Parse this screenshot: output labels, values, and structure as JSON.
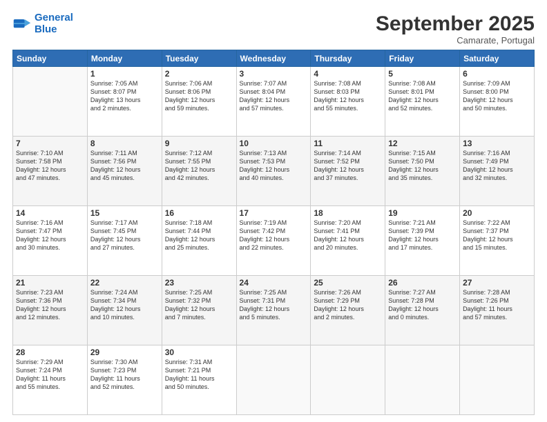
{
  "logo": {
    "line1": "General",
    "line2": "Blue"
  },
  "title": "September 2025",
  "subtitle": "Camarate, Portugal",
  "days_header": [
    "Sunday",
    "Monday",
    "Tuesday",
    "Wednesday",
    "Thursday",
    "Friday",
    "Saturday"
  ],
  "weeks": [
    [
      {
        "num": "",
        "info": ""
      },
      {
        "num": "1",
        "info": "Sunrise: 7:05 AM\nSunset: 8:07 PM\nDaylight: 13 hours\nand 2 minutes."
      },
      {
        "num": "2",
        "info": "Sunrise: 7:06 AM\nSunset: 8:06 PM\nDaylight: 12 hours\nand 59 minutes."
      },
      {
        "num": "3",
        "info": "Sunrise: 7:07 AM\nSunset: 8:04 PM\nDaylight: 12 hours\nand 57 minutes."
      },
      {
        "num": "4",
        "info": "Sunrise: 7:08 AM\nSunset: 8:03 PM\nDaylight: 12 hours\nand 55 minutes."
      },
      {
        "num": "5",
        "info": "Sunrise: 7:08 AM\nSunset: 8:01 PM\nDaylight: 12 hours\nand 52 minutes."
      },
      {
        "num": "6",
        "info": "Sunrise: 7:09 AM\nSunset: 8:00 PM\nDaylight: 12 hours\nand 50 minutes."
      }
    ],
    [
      {
        "num": "7",
        "info": "Sunrise: 7:10 AM\nSunset: 7:58 PM\nDaylight: 12 hours\nand 47 minutes."
      },
      {
        "num": "8",
        "info": "Sunrise: 7:11 AM\nSunset: 7:56 PM\nDaylight: 12 hours\nand 45 minutes."
      },
      {
        "num": "9",
        "info": "Sunrise: 7:12 AM\nSunset: 7:55 PM\nDaylight: 12 hours\nand 42 minutes."
      },
      {
        "num": "10",
        "info": "Sunrise: 7:13 AM\nSunset: 7:53 PM\nDaylight: 12 hours\nand 40 minutes."
      },
      {
        "num": "11",
        "info": "Sunrise: 7:14 AM\nSunset: 7:52 PM\nDaylight: 12 hours\nand 37 minutes."
      },
      {
        "num": "12",
        "info": "Sunrise: 7:15 AM\nSunset: 7:50 PM\nDaylight: 12 hours\nand 35 minutes."
      },
      {
        "num": "13",
        "info": "Sunrise: 7:16 AM\nSunset: 7:49 PM\nDaylight: 12 hours\nand 32 minutes."
      }
    ],
    [
      {
        "num": "14",
        "info": "Sunrise: 7:16 AM\nSunset: 7:47 PM\nDaylight: 12 hours\nand 30 minutes."
      },
      {
        "num": "15",
        "info": "Sunrise: 7:17 AM\nSunset: 7:45 PM\nDaylight: 12 hours\nand 27 minutes."
      },
      {
        "num": "16",
        "info": "Sunrise: 7:18 AM\nSunset: 7:44 PM\nDaylight: 12 hours\nand 25 minutes."
      },
      {
        "num": "17",
        "info": "Sunrise: 7:19 AM\nSunset: 7:42 PM\nDaylight: 12 hours\nand 22 minutes."
      },
      {
        "num": "18",
        "info": "Sunrise: 7:20 AM\nSunset: 7:41 PM\nDaylight: 12 hours\nand 20 minutes."
      },
      {
        "num": "19",
        "info": "Sunrise: 7:21 AM\nSunset: 7:39 PM\nDaylight: 12 hours\nand 17 minutes."
      },
      {
        "num": "20",
        "info": "Sunrise: 7:22 AM\nSunset: 7:37 PM\nDaylight: 12 hours\nand 15 minutes."
      }
    ],
    [
      {
        "num": "21",
        "info": "Sunrise: 7:23 AM\nSunset: 7:36 PM\nDaylight: 12 hours\nand 12 minutes."
      },
      {
        "num": "22",
        "info": "Sunrise: 7:24 AM\nSunset: 7:34 PM\nDaylight: 12 hours\nand 10 minutes."
      },
      {
        "num": "23",
        "info": "Sunrise: 7:25 AM\nSunset: 7:32 PM\nDaylight: 12 hours\nand 7 minutes."
      },
      {
        "num": "24",
        "info": "Sunrise: 7:25 AM\nSunset: 7:31 PM\nDaylight: 12 hours\nand 5 minutes."
      },
      {
        "num": "25",
        "info": "Sunrise: 7:26 AM\nSunset: 7:29 PM\nDaylight: 12 hours\nand 2 minutes."
      },
      {
        "num": "26",
        "info": "Sunrise: 7:27 AM\nSunset: 7:28 PM\nDaylight: 12 hours\nand 0 minutes."
      },
      {
        "num": "27",
        "info": "Sunrise: 7:28 AM\nSunset: 7:26 PM\nDaylight: 11 hours\nand 57 minutes."
      }
    ],
    [
      {
        "num": "28",
        "info": "Sunrise: 7:29 AM\nSunset: 7:24 PM\nDaylight: 11 hours\nand 55 minutes."
      },
      {
        "num": "29",
        "info": "Sunrise: 7:30 AM\nSunset: 7:23 PM\nDaylight: 11 hours\nand 52 minutes."
      },
      {
        "num": "30",
        "info": "Sunrise: 7:31 AM\nSunset: 7:21 PM\nDaylight: 11 hours\nand 50 minutes."
      },
      {
        "num": "",
        "info": ""
      },
      {
        "num": "",
        "info": ""
      },
      {
        "num": "",
        "info": ""
      },
      {
        "num": "",
        "info": ""
      }
    ]
  ]
}
